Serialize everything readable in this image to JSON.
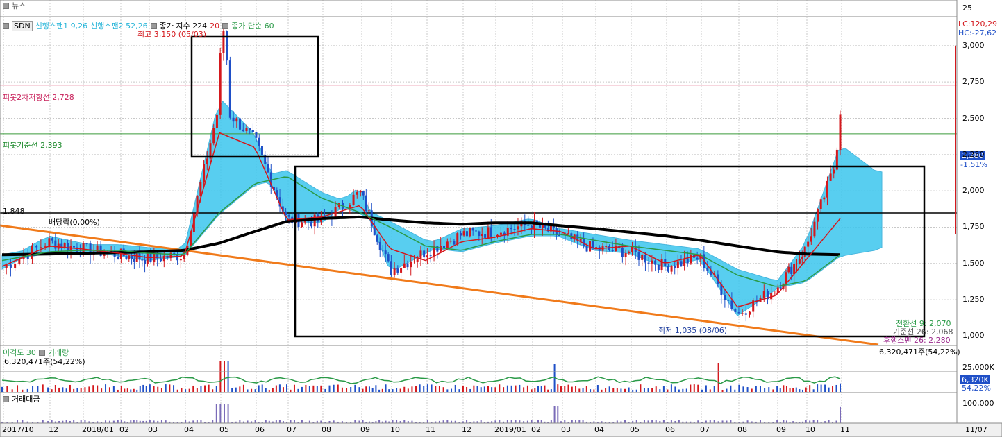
{
  "news_panel": {
    "label": "뉴스",
    "axis_value": "25"
  },
  "price_panel": {
    "symbol": "SDN",
    "legend": [
      {
        "text": "선행스팬1 9,26",
        "color": "#27b5d8"
      },
      {
        "text": "선행스팬2 52,26",
        "color": "#27b5d8"
      },
      {
        "text": "종가 지수 224",
        "color": "#000000"
      },
      {
        "text": "20",
        "color": "#d4181d"
      },
      {
        "text": "종가 단순 60",
        "color": "#2a9a47"
      }
    ],
    "high_marker": "최고 3,150 (05/03)",
    "low_marker": "최저 1,035 (08/06)",
    "lc": "LC:120,29",
    "hc": "HC:-27,62",
    "pivot_resistance": "피봇2차저항선 2,728",
    "pivot_base": "피봇기준선 2,393",
    "level_label": "1,848",
    "dividend_label": "배당락(0,00%)",
    "current_price": "2,280",
    "current_change": "-1,51%",
    "ichimoku_labels": [
      {
        "text": "전환선 9: 2,070",
        "color": "#2a9a47"
      },
      {
        "text": "기준선 26: 2,068",
        "color": "#555555"
      },
      {
        "text": "후행스팬 26: 2,280",
        "color": "#9b2a8c"
      }
    ],
    "volume_right_label": "6,320,471주(54,22%)"
  },
  "volume_panel": {
    "title": "이격도 30",
    "title2": "거래량",
    "value_label": "6,320,471주(54,22%)",
    "axis_value": "25,000K",
    "current": "6,320K",
    "pct": "54,22%"
  },
  "amount_panel": {
    "title": "거래대금",
    "axis_value": "100,000"
  },
  "x_axis": {
    "labels": [
      "2017/10",
      "12",
      "2018/01",
      "02",
      "03",
      "04",
      "05",
      "06",
      "07",
      "08",
      "09",
      "10",
      "11",
      "12",
      "2019/01",
      "02",
      "03",
      "04",
      "05",
      "06",
      "07",
      "08",
      "09",
      "10",
      "11"
    ],
    "right_date": "11/07"
  },
  "chart_data": {
    "type": "candlestick",
    "y_ticks": [
      1000,
      1250,
      1500,
      1750,
      2000,
      2250,
      2500,
      2750,
      3000
    ],
    "ylim": [
      940,
      3200
    ],
    "title": "",
    "xlabel": "",
    "ylabel": "",
    "grid": true,
    "series": [
      {
        "name": "종가 지수 224",
        "months": [
          "2017/10",
          "12",
          "2018/01",
          "02",
          "03",
          "04",
          "05",
          "06",
          "07",
          "08",
          "09",
          "10",
          "11",
          "12",
          "2019/01",
          "02",
          "03",
          "04",
          "05",
          "06",
          "07",
          "08",
          "09",
          "10",
          "11"
        ],
        "values": [
          1560,
          1565,
          1570,
          1575,
          1580,
          1590,
          1640,
          1720,
          1790,
          1810,
          1820,
          1800,
          1780,
          1770,
          1780,
          1780,
          1760,
          1740,
          1715,
          1690,
          1660,
          1620,
          1580,
          1565,
          1560
        ]
      },
      {
        "name": "20",
        "months": [
          "2017/10",
          "12",
          "2018/01",
          "02",
          "03",
          "04",
          "05",
          "06",
          "07",
          "08",
          "09",
          "10",
          "11",
          "12",
          "2019/01",
          "02",
          "03",
          "04",
          "05",
          "06",
          "07",
          "08",
          "09",
          "10",
          "11"
        ],
        "values": [
          1480,
          1620,
          1600,
          1570,
          1540,
          1550,
          2400,
          2300,
          1800,
          1820,
          1900,
          1600,
          1520,
          1650,
          1680,
          1740,
          1720,
          1600,
          1620,
          1500,
          1560,
          1200,
          1280,
          1520,
          1810
        ]
      },
      {
        "name": "종가 단순 60",
        "months": [
          "2017/10",
          "12",
          "2018/01",
          "02",
          "03",
          "04",
          "05",
          "06",
          "07",
          "08",
          "09",
          "10",
          "11",
          "12",
          "2019/01",
          "02",
          "03",
          "04",
          "05",
          "06",
          "07",
          "08",
          "09",
          "10",
          "11"
        ],
        "values": [
          1520,
          1580,
          1590,
          1590,
          1570,
          1560,
          1850,
          2050,
          2100,
          1950,
          1850,
          1750,
          1620,
          1590,
          1650,
          1700,
          1700,
          1660,
          1620,
          1590,
          1560,
          1420,
          1340,
          1380,
          1560
        ]
      },
      {
        "name": "close",
        "months": [
          "2017/10",
          "12",
          "2018/01",
          "02",
          "03",
          "04",
          "05",
          "06",
          "07",
          "08",
          "09",
          "10",
          "11",
          "12",
          "2019/01",
          "02",
          "03",
          "04",
          "05",
          "06",
          "07",
          "08",
          "09",
          "10",
          "11"
        ],
        "values": [
          1470,
          1650,
          1600,
          1560,
          1530,
          1560,
          2600,
          2350,
          1800,
          1790,
          1990,
          1450,
          1580,
          1700,
          1720,
          1770,
          1690,
          1600,
          1580,
          1480,
          1540,
          1150,
          1330,
          1600,
          2280
        ]
      }
    ],
    "horizontal_lines": [
      {
        "name": "피봇2차저항선",
        "value": 2728
      },
      {
        "name": "피봇기준선",
        "value": 2393
      },
      {
        "name": "1,848",
        "value": 1848
      }
    ],
    "extremes": {
      "high": {
        "value": 3150,
        "date": "05/03"
      },
      "low": {
        "value": 1035,
        "date": "08/06"
      }
    }
  }
}
